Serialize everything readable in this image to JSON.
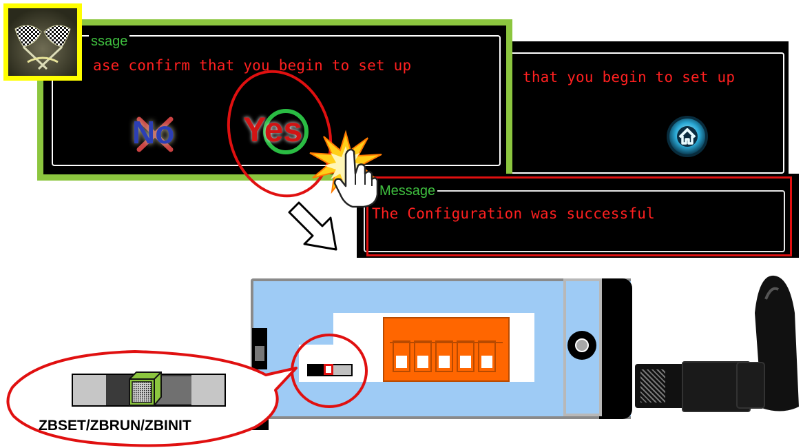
{
  "dialog_confirm": {
    "legend": "ssage",
    "message": "ase confirm that you begin to set up",
    "no_label": "No",
    "yes_label": "Yes"
  },
  "dialog_back": {
    "message": "that you begin to set up",
    "home_icon": "home-icon"
  },
  "dialog_result": {
    "legend": "Message",
    "message": "The Configuration was successful"
  },
  "switch_callout": {
    "label": "ZBSET/ZBRUN/ZBINIT"
  },
  "icons": [
    "checkered-flags-icon",
    "pointing-hand-cursor-icon",
    "click-burst-icon",
    "down-right-arrow-icon",
    "home-icon"
  ],
  "colors": {
    "dialog_bg": "#000000",
    "highlight_green": "#8cc63f",
    "highlight_yellow": "#ffff00",
    "message_red": "#ff2020",
    "legend_green": "#3fbf3f",
    "callout_red": "#e01010",
    "device_blue": "#9ecbf5",
    "terminal_orange": "#ff6600"
  }
}
